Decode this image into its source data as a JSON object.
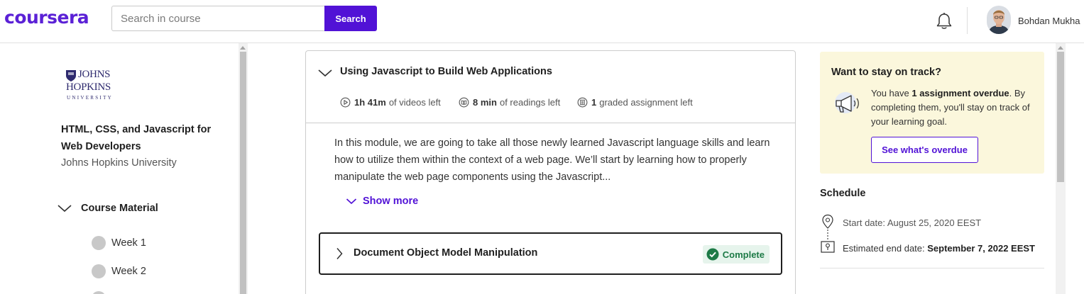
{
  "header": {
    "logo": "coursera",
    "search_placeholder": "Search in course",
    "search_button": "Search",
    "user_name": "Bohdan Mukha"
  },
  "sidebar": {
    "university_logo": {
      "line1": "JOHNS",
      "line2": "HOPKINS",
      "line3": "UNIVERSITY"
    },
    "course_title": "HTML, CSS, and Javascript for Web Developers",
    "university": "Johns Hopkins University",
    "section_label": "Course Material",
    "weeks": [
      "Week 1",
      "Week 2"
    ]
  },
  "module": {
    "title": "Using Javascript to Build Web Applications",
    "meta": {
      "videos_value": "1h 41m",
      "videos_text": "of videos left",
      "readings_value": "8 min",
      "readings_text": "of readings left",
      "assignments_value": "1",
      "assignments_text": "graded assignment left"
    },
    "description": "In this module, we are going to take all those newly learned Javascript language skills and learn how to utilize them within the context of a web page. We’ll start by learning how to properly manipulate the web page components using the Javascript...",
    "show_more": "Show more",
    "lesson": {
      "title": "Document Object Model Manipulation",
      "status": "Complete"
    }
  },
  "track_panel": {
    "title": "Want to stay on track?",
    "text_prefix": "You have ",
    "text_bold": "1 assignment overdue",
    "text_suffix": ". By completing them, you'll stay on track of your learning goal.",
    "button": "See what's overdue"
  },
  "schedule": {
    "title": "Schedule",
    "start_date": "Start date: August 25, 2020 EEST",
    "end_label": "Estimated end date: ",
    "end_value": "September 7, 2022 EEST"
  },
  "colors": {
    "brand": "#5112d6",
    "complete": "#1d7a46",
    "track_bg": "#fbf7dc"
  }
}
